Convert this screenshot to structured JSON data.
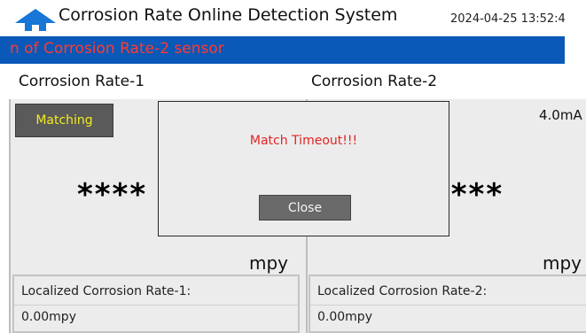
{
  "header": {
    "home_icon": "home-icon",
    "title": "Corrosion Rate Online Detection System",
    "datetime": "2024-04-25 13:52:4"
  },
  "marquee": {
    "text": "n of Corrosion Rate-2 sensor",
    "background_color": "#0a58b8",
    "text_color": "#ff3b2f"
  },
  "channels": [
    {
      "label": "Corrosion Rate-1",
      "button_label": "Matching",
      "reading": "****",
      "unit": "mpy",
      "localized_label": "Localized Corrosion Rate-1:",
      "localized_value": "0.00mpy"
    },
    {
      "label": "Corrosion Rate-2",
      "current": "4.0mA",
      "reading": "****",
      "unit": "mpy",
      "localized_label": "Localized Corrosion Rate-2:",
      "localized_value": "0.00mpy"
    }
  ],
  "dialog": {
    "message": "Match Timeout!!!",
    "close_label": "Close",
    "message_color": "#e02424"
  }
}
